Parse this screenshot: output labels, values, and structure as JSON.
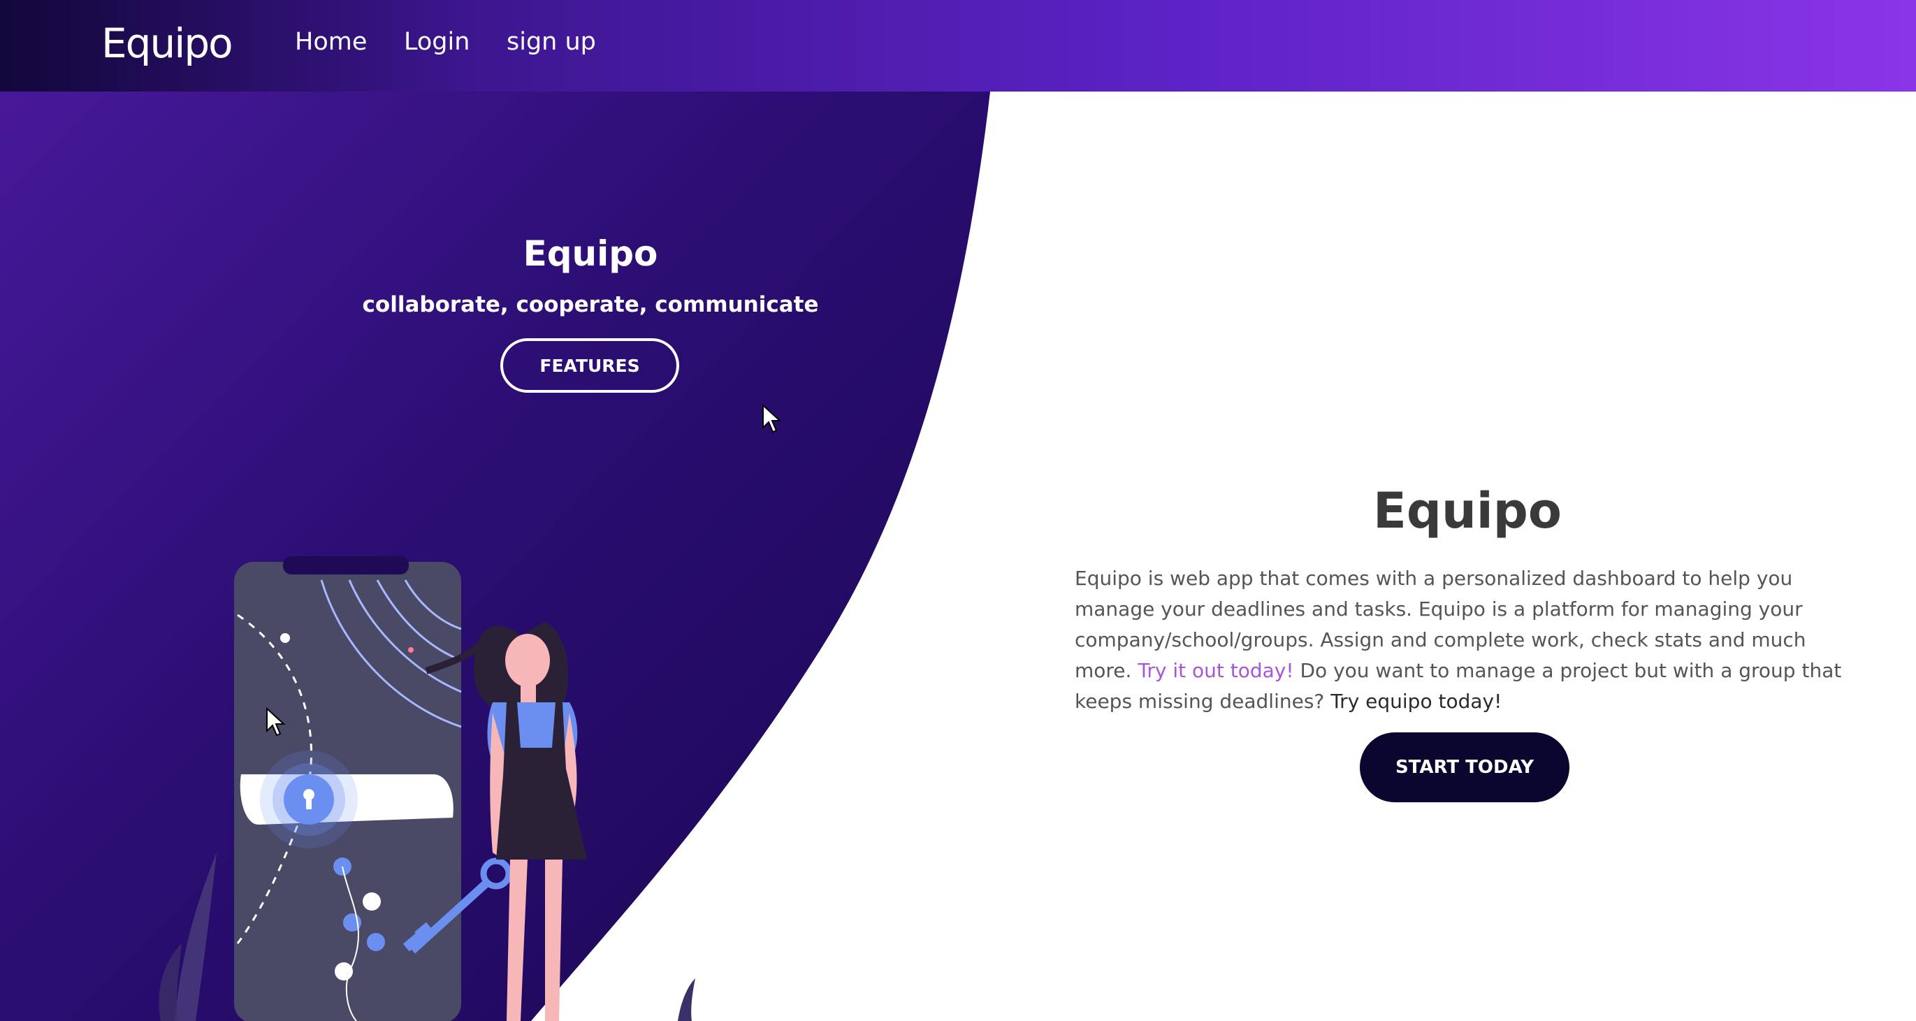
{
  "nav": {
    "brand": "Equipo",
    "links": [
      "Home",
      "Login",
      "sign up"
    ]
  },
  "hero": {
    "title": "Equipo",
    "tagline": "collaborate, cooperate, communicate",
    "features_label": "FEATURES"
  },
  "about": {
    "title": "Equipo",
    "desc_part1": "Equipo is web app that comes with a personalized dashboard to help you manage your deadlines and tasks. Equipo is a platform for managing your company/school/groups. Assign and complete work, check stats and much more. ",
    "highlight": "Try it out today!",
    "desc_part2": " Do you want to manage a project but with a group that keeps missing deadlines? ",
    "desc_emph": "Try equipo today!",
    "cta_label": "START TODAY"
  },
  "colors": {
    "hero_dark": "#1e0a55",
    "hero_purple": "#4a1a9e",
    "accent_link": "#a855d8",
    "cta_bg": "#0b0630"
  },
  "icons": [
    "keyhole-icon",
    "cursor-icon"
  ]
}
